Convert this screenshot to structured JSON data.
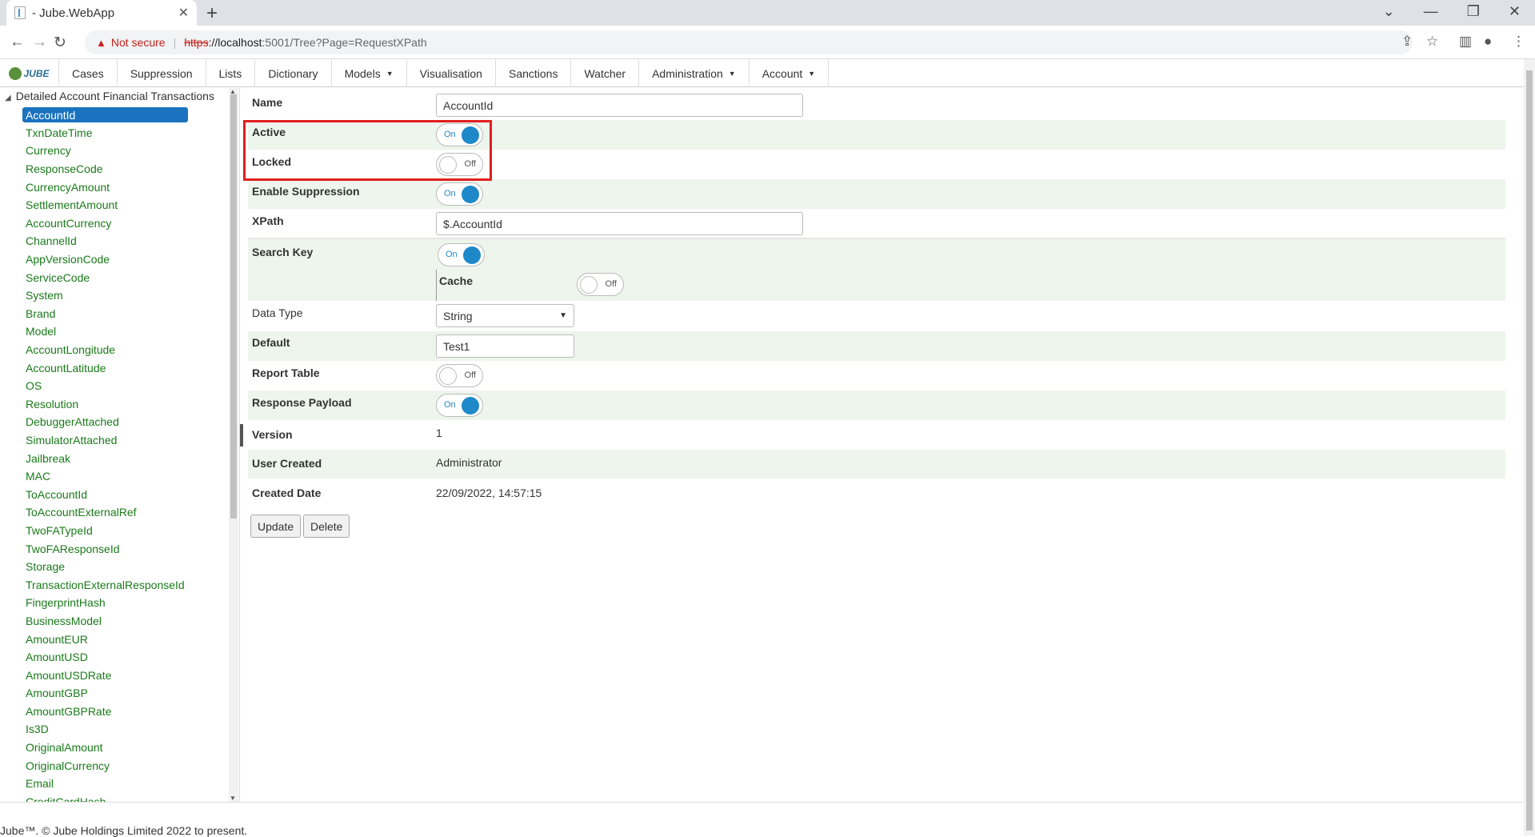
{
  "browser": {
    "tab_title": "- Jube.WebApp",
    "tab_close": "✕",
    "new_tab": "+",
    "security_label": "Not secure",
    "url_scheme": "https",
    "url_host": "://localhost",
    "url_path": ":5001/Tree?Page=RequestXPath"
  },
  "menu": {
    "logo": "JUBE",
    "items": [
      "Cases",
      "Suppression",
      "Lists",
      "Dictionary",
      "Models",
      "Visualisation",
      "Sanctions",
      "Watcher",
      "Administration",
      "Account"
    ]
  },
  "tree": {
    "root": "Detailed Account Financial Transactions",
    "selected": "AccountId",
    "items": [
      "AccountId",
      "TxnDateTime",
      "Currency",
      "ResponseCode",
      "CurrencyAmount",
      "SettlementAmount",
      "AccountCurrency",
      "ChannelId",
      "AppVersionCode",
      "ServiceCode",
      "System",
      "Brand",
      "Model",
      "AccountLongitude",
      "AccountLatitude",
      "OS",
      "Resolution",
      "DebuggerAttached",
      "SimulatorAttached",
      "Jailbreak",
      "MAC",
      "ToAccountId",
      "ToAccountExternalRef",
      "TwoFATypeId",
      "TwoFAResponseId",
      "Storage",
      "TransactionExternalResponseId",
      "FingerprintHash",
      "BusinessModel",
      "AmountEUR",
      "AmountUSD",
      "AmountUSDRate",
      "AmountGBP",
      "AmountGBPRate",
      "Is3D",
      "OriginalAmount",
      "OriginalCurrency",
      "Email",
      "CreditCardHash"
    ]
  },
  "form": {
    "name_label": "Name",
    "name_value": "AccountId",
    "active_label": "Active",
    "active_state": "On",
    "locked_label": "Locked",
    "locked_state": "Off",
    "suppression_label": "Enable Suppression",
    "suppression_state": "On",
    "xpath_label": "XPath",
    "xpath_value": "$.AccountId",
    "search_key_label": "Search Key",
    "search_key_state": "On",
    "cache_label": "Cache",
    "cache_state": "Off",
    "data_type_label": "Data Type",
    "data_type_value": "String",
    "default_label": "Default",
    "default_value": "Test1",
    "report_table_label": "Report Table",
    "report_table_state": "Off",
    "response_payload_label": "Response Payload",
    "response_payload_state": "On",
    "version_label": "Version",
    "version_value": "1",
    "user_created_label": "User Created",
    "user_created_value": "Administrator",
    "created_date_label": "Created Date",
    "created_date_value": "22/09/2022, 14:57:15",
    "update_button": "Update",
    "delete_button": "Delete"
  },
  "footer": "Jube™. © Jube Holdings Limited 2022 to present.",
  "colors": {
    "accent": "#1e88c9",
    "tree_link": "#1a7a1a",
    "highlight": "#e01e1e",
    "alt_row": "#eef5ec"
  }
}
